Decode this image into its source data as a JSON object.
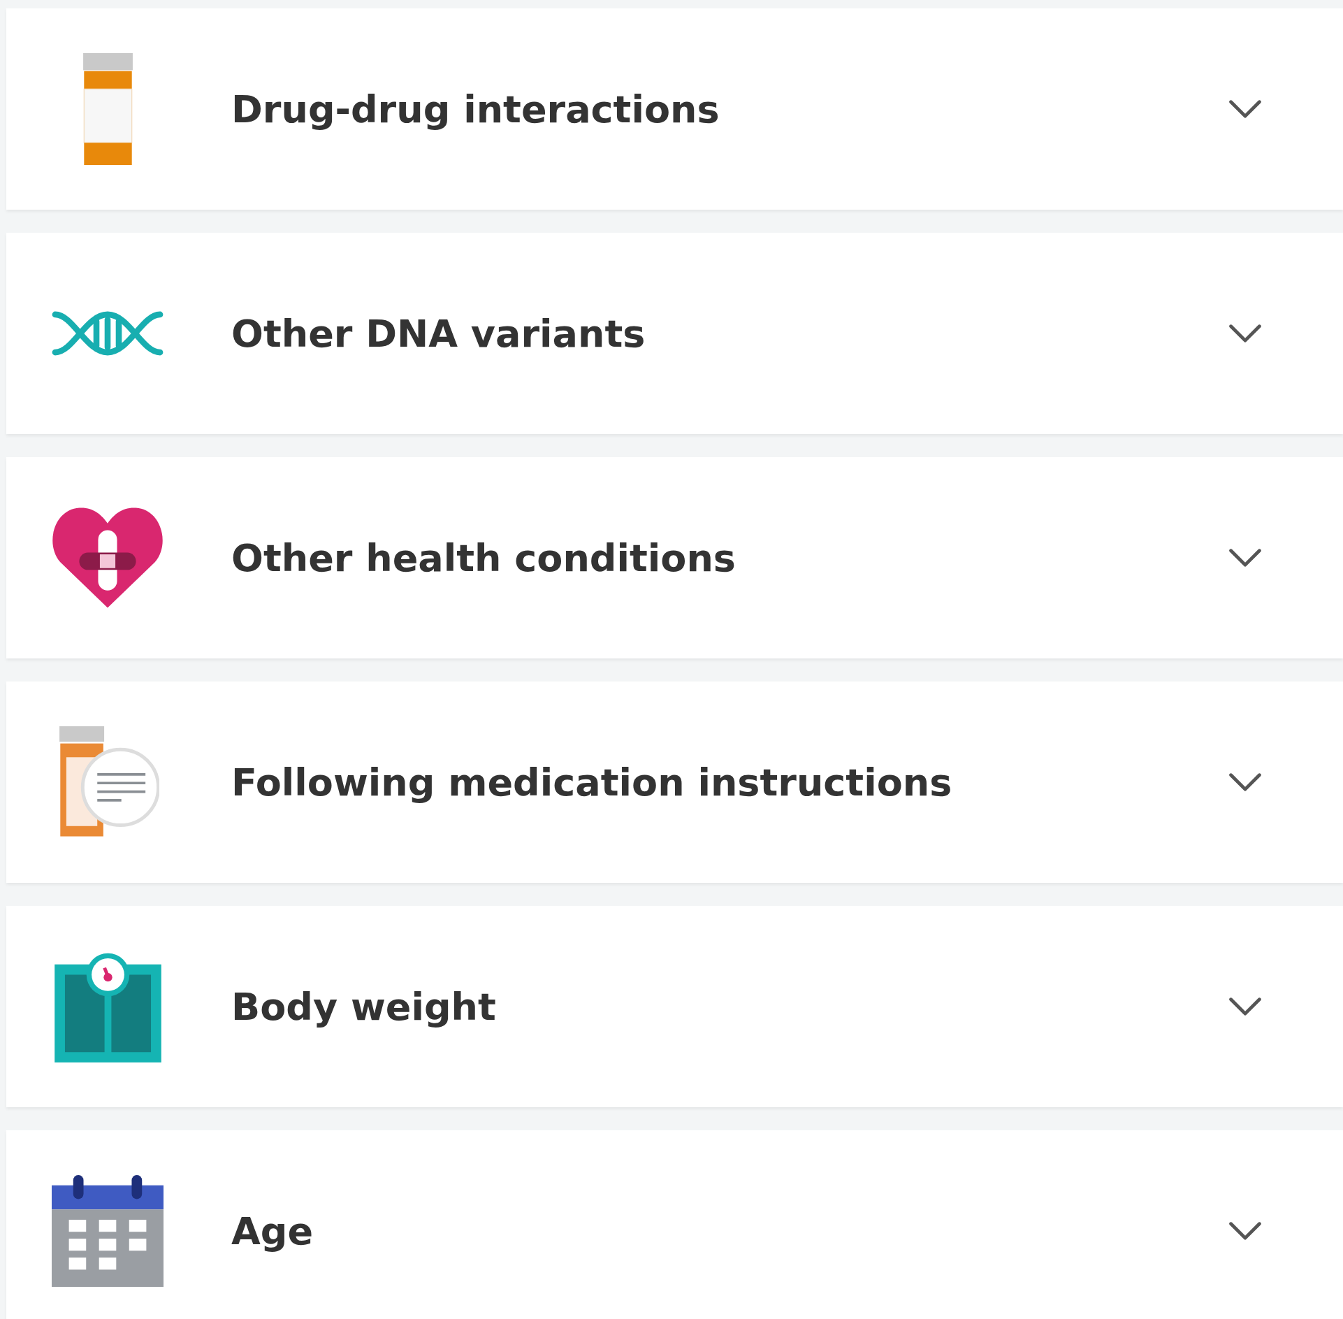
{
  "sections": [
    {
      "kind": "bottle",
      "title": "Drug-drug interactions",
      "expanded": false
    },
    {
      "kind": "dna",
      "title": "Other DNA variants",
      "expanded": false
    },
    {
      "kind": "heart",
      "title": "Other health conditions",
      "expanded": false
    },
    {
      "kind": "instructions",
      "title": "Following medication instructions",
      "expanded": false
    },
    {
      "kind": "scale",
      "title": "Body weight",
      "expanded": false
    },
    {
      "kind": "calendar",
      "title": "Age",
      "expanded": false
    }
  ]
}
